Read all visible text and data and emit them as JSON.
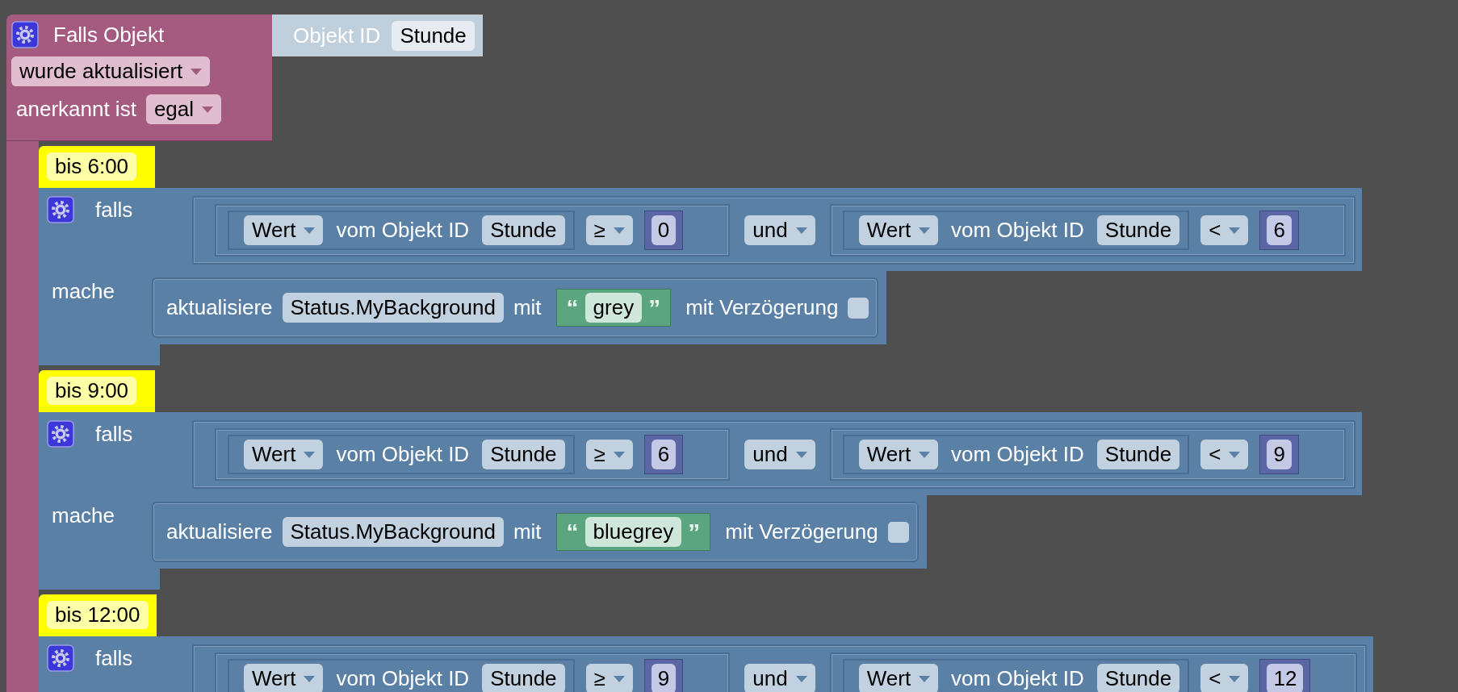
{
  "trigger": {
    "title": "Falls Objekt",
    "object_label": "Objekt ID",
    "object_value": "Stunde",
    "event": "wurde aktualisiert",
    "ack_label": "anerkannt ist",
    "ack": "egal"
  },
  "rules": [
    {
      "comment": "bis 6:00",
      "if_label": "falls",
      "joiner": "und",
      "conditions": [
        {
          "field": "Wert",
          "label": "vom Objekt ID",
          "object": "Stunde",
          "op": "≥",
          "value": "0"
        },
        {
          "field": "Wert",
          "label": "vom Objekt ID",
          "object": "Stunde",
          "op": "<",
          "value": "6"
        }
      ],
      "do_label": "mache",
      "action": {
        "verb": "aktualisiere",
        "target": "Status.MyBackground",
        "with": "mit",
        "open_quote": "“",
        "text": "grey",
        "close_quote": "”",
        "delay_label": "mit Verzögerung",
        "delay_checked": false
      }
    },
    {
      "comment": "bis 9:00",
      "if_label": "falls",
      "joiner": "und",
      "conditions": [
        {
          "field": "Wert",
          "label": "vom Objekt ID",
          "object": "Stunde",
          "op": "≥",
          "value": "6"
        },
        {
          "field": "Wert",
          "label": "vom Objekt ID",
          "object": "Stunde",
          "op": "<",
          "value": "9"
        }
      ],
      "do_label": "mache",
      "action": {
        "verb": "aktualisiere",
        "target": "Status.MyBackground",
        "with": "mit",
        "open_quote": "“",
        "text": "bluegrey",
        "close_quote": "”",
        "delay_label": "mit Verzögerung",
        "delay_checked": false
      }
    },
    {
      "comment": "bis 12:00",
      "if_label": "falls",
      "joiner": "und",
      "conditions": [
        {
          "field": "Wert",
          "label": "vom Objekt ID",
          "object": "Stunde",
          "op": "≥",
          "value": "9"
        },
        {
          "field": "Wert",
          "label": "vom Objekt ID",
          "object": "Stunde",
          "op": "<",
          "value": "12"
        }
      ]
    }
  ]
}
